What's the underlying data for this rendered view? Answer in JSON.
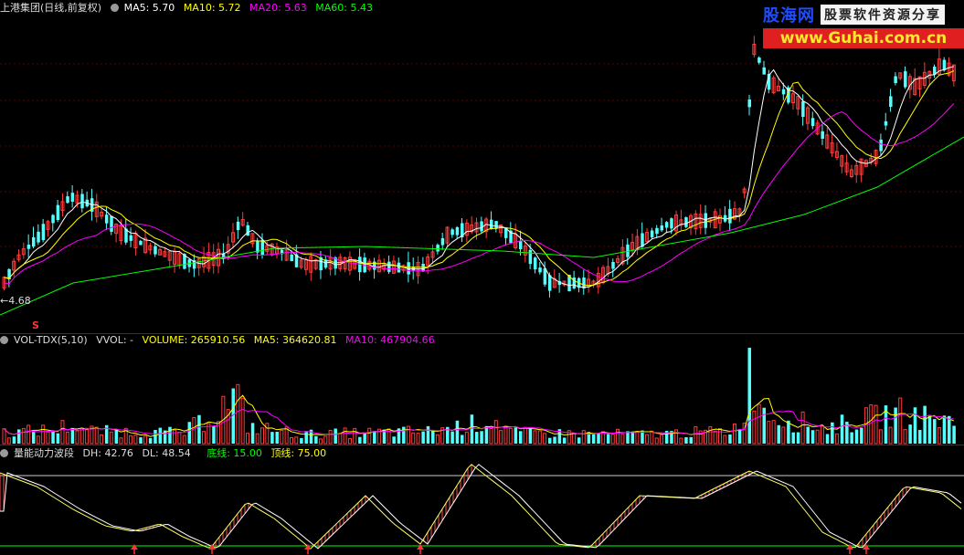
{
  "main": {
    "title": "上港集团(日线,前复权)",
    "ma5": "MA5: 5.70",
    "ma10": "MA10: 5.72",
    "ma20": "MA20: 5.63",
    "ma60": "MA60: 5.43",
    "low_label": "4.68",
    "marker": "S"
  },
  "volume": {
    "name": "VOL-TDX(5,10)",
    "vvol": "VVOL: -",
    "volume": "VOLUME: 265910.56",
    "ma5": "MA5: 364620.81",
    "ma10": "MA10: 467904.66"
  },
  "indicator": {
    "name": "量能动力波段",
    "dh": "DH: 42.76",
    "dl": "DL: 48.54",
    "floor": "底线: 15.00",
    "top": "顶线: 75.00"
  },
  "watermark": {
    "logo": "股海网",
    "slogan": "股票软件资源分享",
    "url": "www.Guhai.com.cn"
  },
  "colors": {
    "background": "#000000",
    "up": "#ff3c3c",
    "down": "#54ffff",
    "ma5": "#ffffff",
    "ma10": "#ffff00",
    "ma20": "#ff00ff",
    "ma60": "#00ff00",
    "separator": "#b00000"
  }
}
